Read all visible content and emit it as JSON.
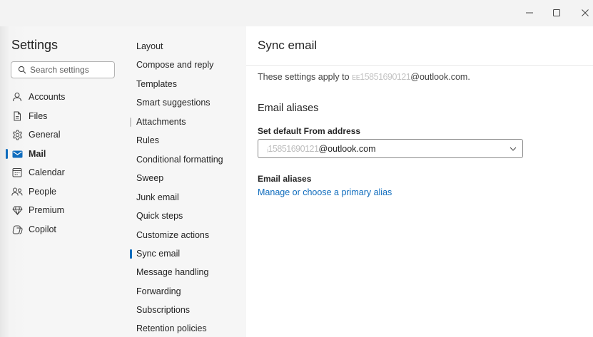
{
  "window": {
    "controls": [
      "minimize",
      "maximize",
      "close"
    ]
  },
  "sidebar": {
    "title": "Settings",
    "search_placeholder": "Search settings",
    "items": [
      {
        "label": "Accounts",
        "icon": "person-icon"
      },
      {
        "label": "Files",
        "icon": "file-icon"
      },
      {
        "label": "General",
        "icon": "gear-icon"
      },
      {
        "label": "Mail",
        "icon": "mail-icon",
        "selected": true
      },
      {
        "label": "Calendar",
        "icon": "calendar-icon"
      },
      {
        "label": "People",
        "icon": "people-icon"
      },
      {
        "label": "Premium",
        "icon": "diamond-icon"
      },
      {
        "label": "Copilot",
        "icon": "copilot-icon"
      }
    ]
  },
  "mail_nav": {
    "items": [
      {
        "label": "Layout"
      },
      {
        "label": "Compose and reply"
      },
      {
        "label": "Templates"
      },
      {
        "label": "Smart suggestions"
      },
      {
        "label": "Attachments"
      },
      {
        "label": "Rules"
      },
      {
        "label": "Conditional formatting"
      },
      {
        "label": "Sweep"
      },
      {
        "label": "Junk email"
      },
      {
        "label": "Quick steps"
      },
      {
        "label": "Customize actions"
      },
      {
        "label": "Sync email",
        "selected": true
      },
      {
        "label": "Message handling"
      },
      {
        "label": "Forwarding"
      },
      {
        "label": "Subscriptions"
      },
      {
        "label": "Retention policies"
      }
    ]
  },
  "content": {
    "title": "Sync email",
    "apply_prefix": "These settings apply to ",
    "apply_masked": "ᴇᴇ15851690121",
    "apply_suffix": "@outlook.com.",
    "section_title": "Email aliases",
    "default_from_label": "Set default From address",
    "default_from_masked": "ᵢ15851690121",
    "default_from_suffix": "@outlook.com",
    "aliases_label": "Email aliases",
    "aliases_link": "Manage or choose a primary alias"
  },
  "colors": {
    "accent": "#0f6cbd",
    "sidebar_bg": "#f6f6f6",
    "content_bg": "#ffffff",
    "titlebar_bg": "#f3f3f3"
  }
}
